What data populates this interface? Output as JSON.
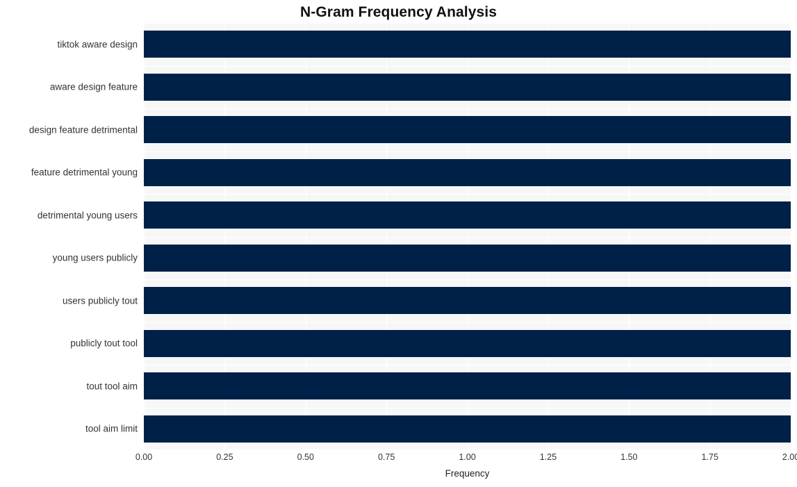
{
  "chart_data": {
    "type": "bar",
    "orientation": "horizontal",
    "title": "N-Gram Frequency Analysis",
    "xlabel": "Frequency",
    "ylabel": "",
    "categories": [
      "tiktok aware design",
      "aware design feature",
      "design feature detrimental",
      "feature detrimental young",
      "detrimental young users",
      "young users publicly",
      "users publicly tout",
      "publicly tout tool",
      "tout tool aim",
      "tool aim limit"
    ],
    "values": [
      2,
      2,
      2,
      2,
      2,
      2,
      2,
      2,
      2,
      2
    ],
    "xlim": [
      0.0,
      2.0
    ],
    "xticks": [
      "0.00",
      "0.25",
      "0.50",
      "0.75",
      "1.00",
      "1.25",
      "1.50",
      "1.75",
      "2.00"
    ],
    "xtick_values": [
      0.0,
      0.25,
      0.5,
      0.75,
      1.0,
      1.25,
      1.5,
      1.75,
      2.0
    ],
    "grid": true,
    "legend": null,
    "bar_color": "#002147",
    "plot_background": "#f7f7f7",
    "figure_background": "#ffffff",
    "gridline_color": "#ffffff",
    "text_color": "#333333",
    "title_color": "#111111"
  }
}
